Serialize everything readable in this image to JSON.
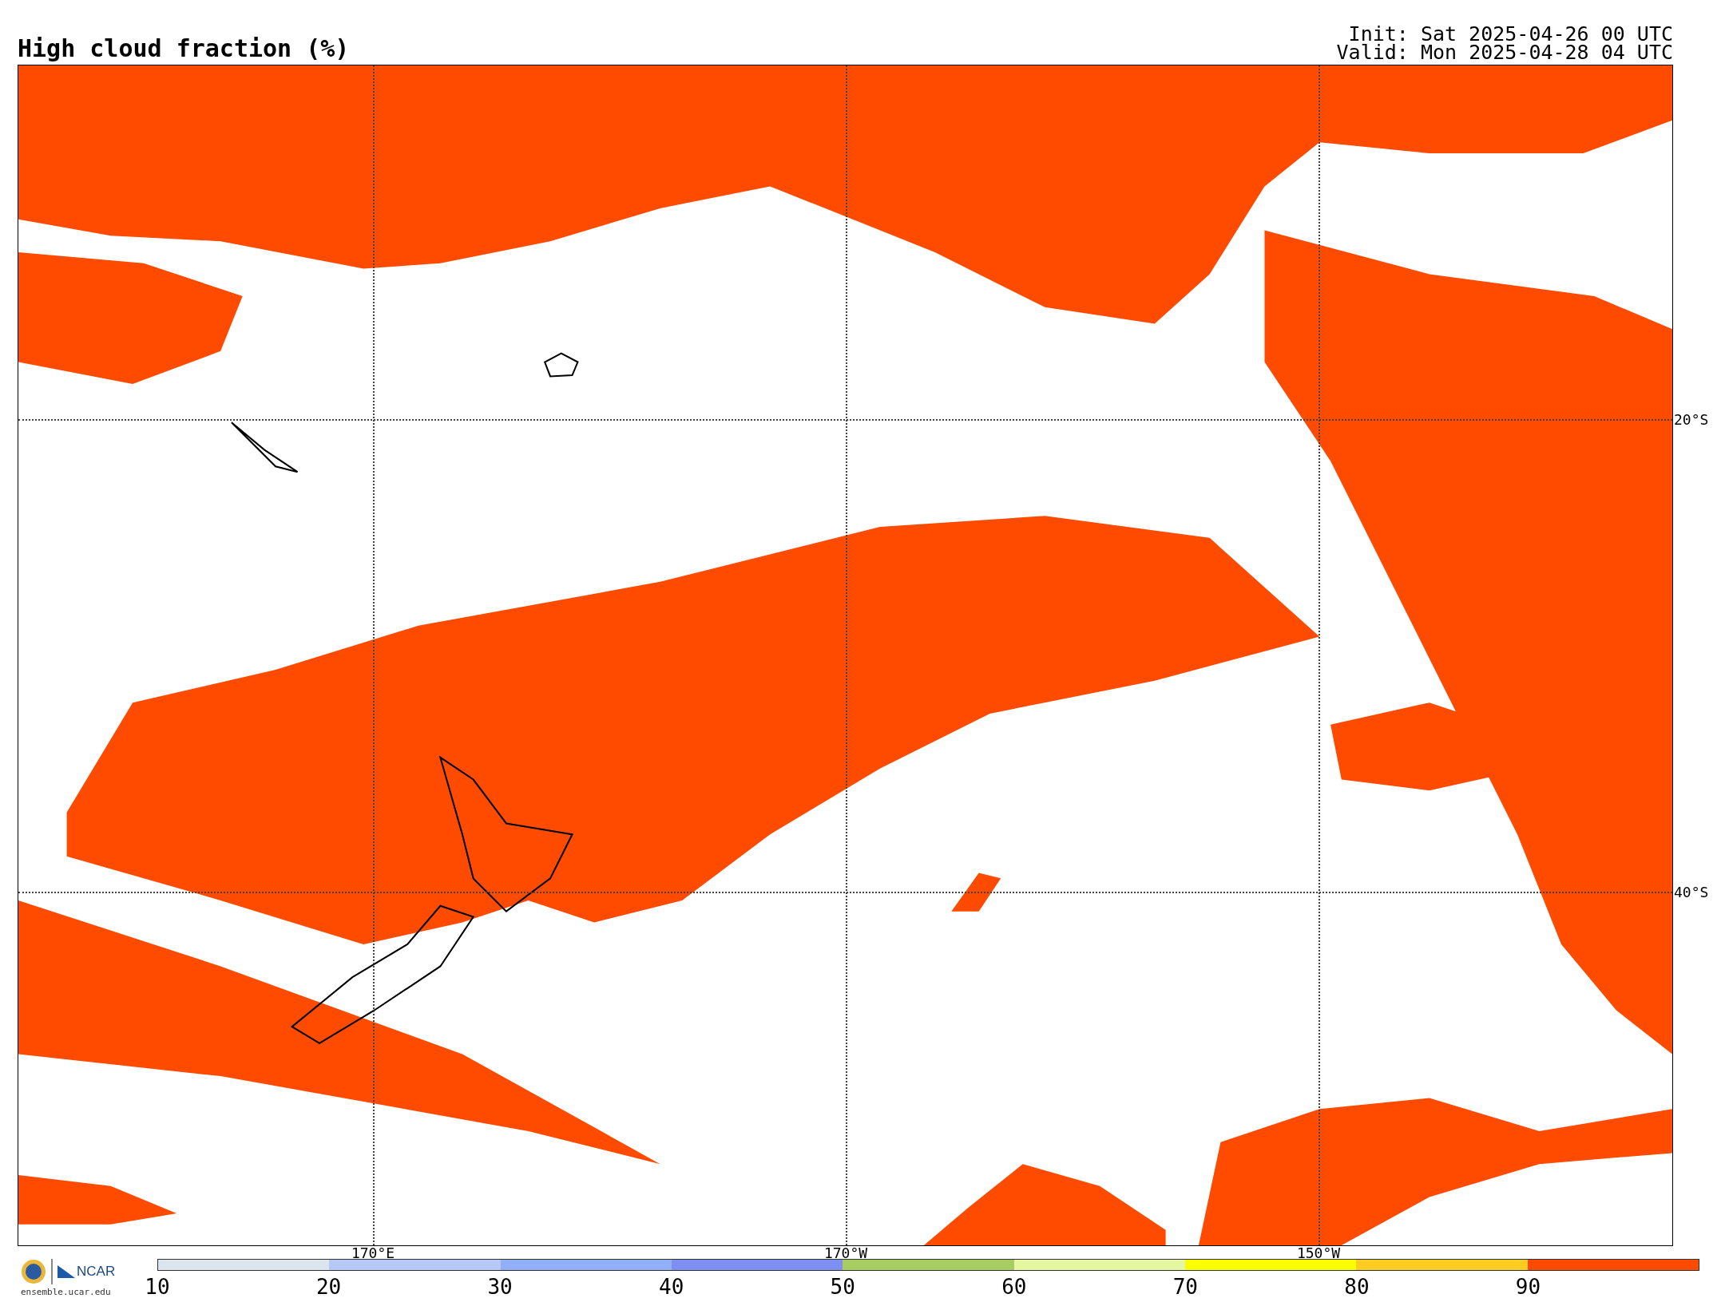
{
  "title": "High cloud fraction (%)",
  "init": "Init: Sat 2025-04-26 00 UTC",
  "valid": "Valid: Mon 2025-04-28 04 UTC",
  "map": {
    "latitude_labels": [
      "20°S",
      "40°S"
    ],
    "longitude_labels": [
      "170°E",
      "170°W",
      "150°W"
    ]
  },
  "colorbar": {
    "segments": [
      {
        "color": "#dbe5ee"
      },
      {
        "color": "#b5c8f6"
      },
      {
        "color": "#90aff6"
      },
      {
        "color": "#7e8ff2"
      },
      {
        "color": "#a7cd62"
      },
      {
        "color": "#e6f7a2"
      },
      {
        "color": "#ffff00"
      },
      {
        "color": "#ffcc22"
      },
      {
        "color": "#ff4b00"
      }
    ],
    "ticks": [
      "10",
      "20",
      "30",
      "40",
      "50",
      "60",
      "70",
      "80",
      "90"
    ]
  },
  "logo": {
    "name": "NCAR",
    "url": "ensemble.ucar.edu"
  }
}
